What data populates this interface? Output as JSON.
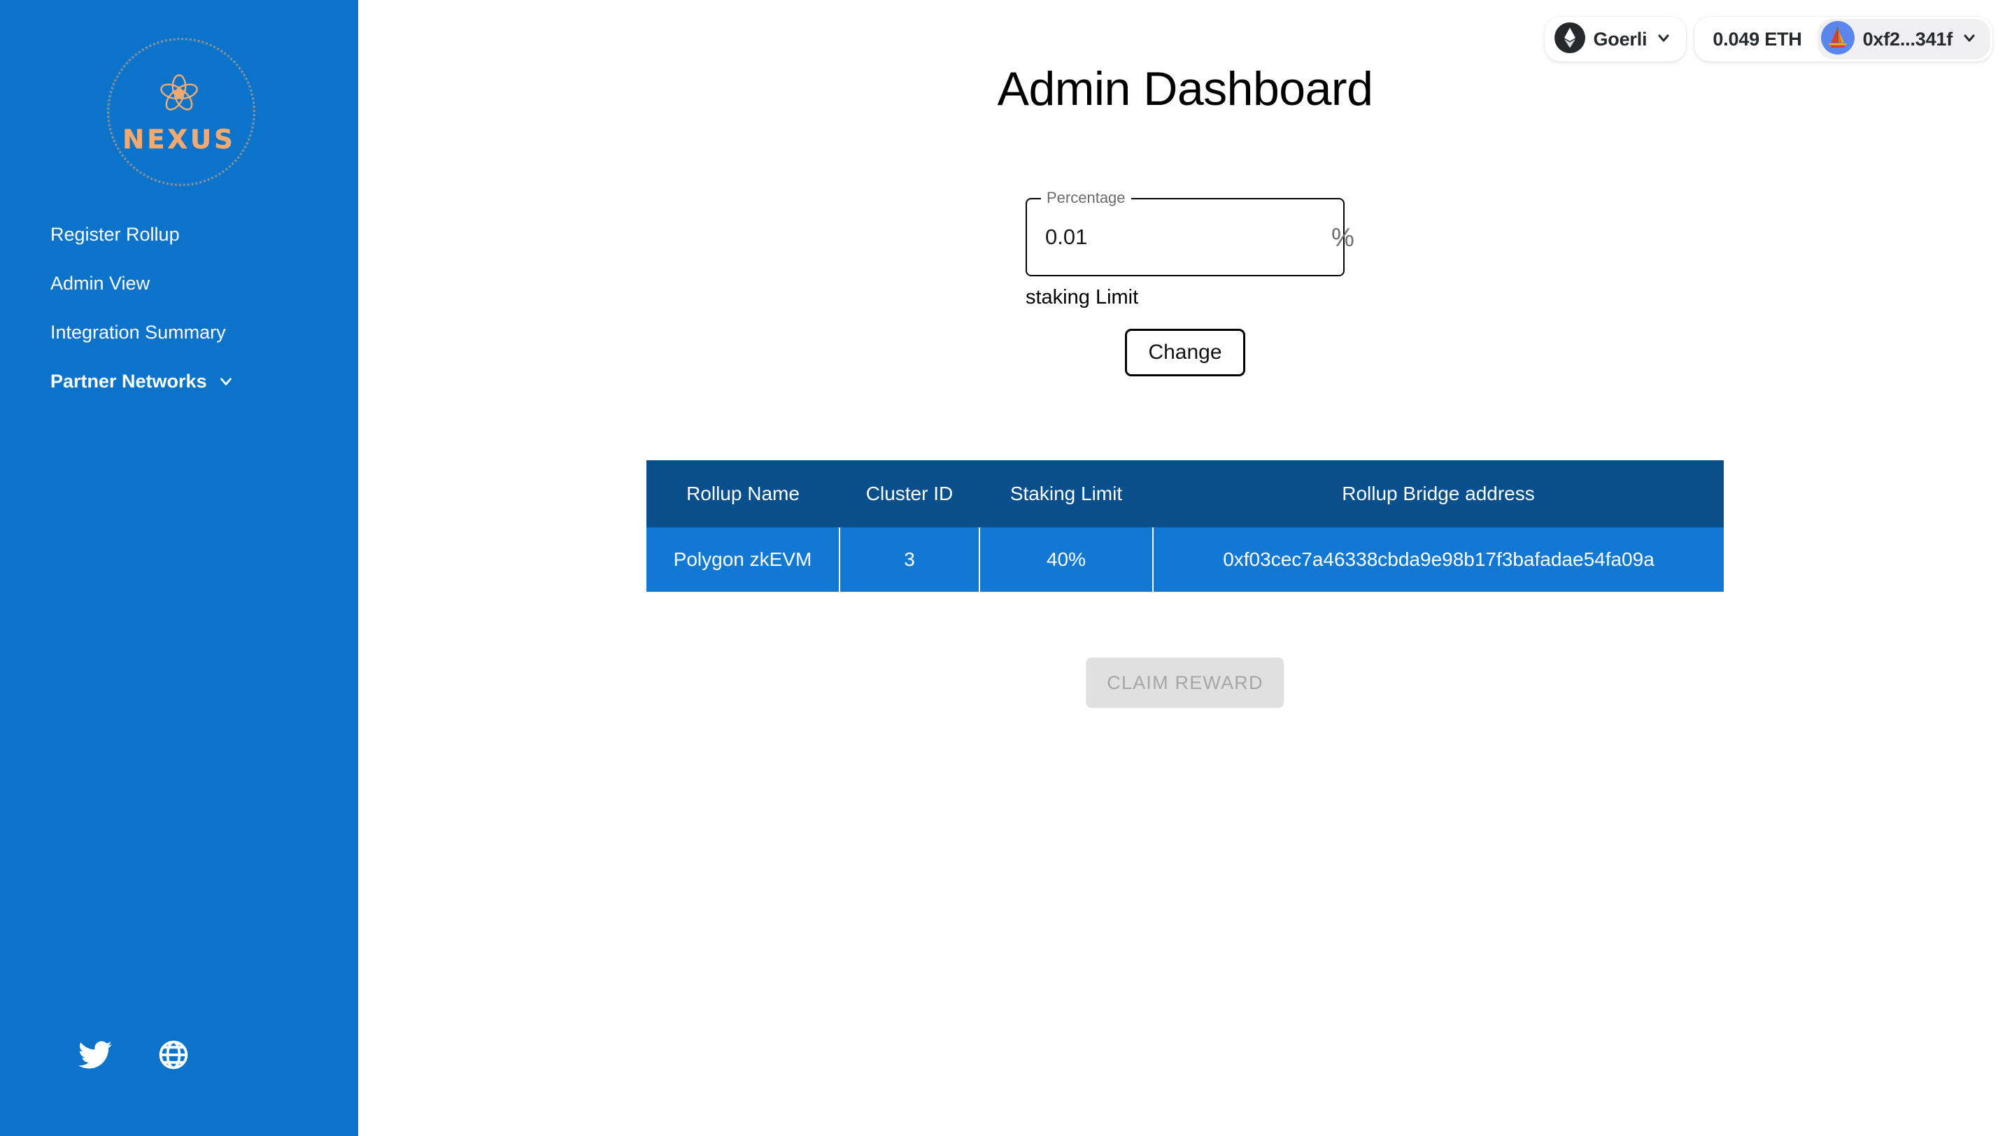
{
  "brand": {
    "name": "NEXUS",
    "logo_icon": "atom-icon",
    "accent_color": "#f2aa70",
    "sidebar_color": "#0b74ca"
  },
  "sidebar": {
    "items": [
      {
        "label": "Register Rollup",
        "icon": null,
        "bold": false
      },
      {
        "label": "Admin View",
        "icon": null,
        "bold": false
      },
      {
        "label": "Integration Summary",
        "icon": null,
        "bold": false
      },
      {
        "label": "Partner Networks",
        "icon": "chevron-down-icon",
        "bold": true
      }
    ],
    "social": [
      {
        "name": "twitter-icon"
      },
      {
        "name": "globe-icon"
      }
    ]
  },
  "wallet": {
    "network": "Goerli",
    "network_icon": "ethereum-icon",
    "network_chevron": "chevron-down-icon",
    "balance": "0.049 ETH",
    "address": "0xf2...341f",
    "avatar_icon": "sailboat-avatar-icon",
    "address_chevron": "chevron-down-icon"
  },
  "header": {
    "title": "Admin Dashboard"
  },
  "staking_form": {
    "field_label": "Percentage",
    "value": "0.01",
    "placeholder": "",
    "adornment": "%",
    "helper_text": "staking Limit",
    "submit_label": "Change"
  },
  "table": {
    "columns": [
      "Rollup Name",
      "Cluster ID",
      "Staking Limit",
      "Rollup Bridge address"
    ],
    "rows": [
      {
        "rollup_name": "Polygon zkEVM",
        "cluster_id": "3",
        "staking_limit": "40%",
        "bridge_address": "0xf03cec7a46338cbda9e98b17f3bafadae54fa09a"
      }
    ],
    "header_color": "#084f8c",
    "row_color": "#1178d4"
  },
  "actions": {
    "claim_reward_label": "CLAIM REWARD",
    "claim_reward_disabled": true
  }
}
